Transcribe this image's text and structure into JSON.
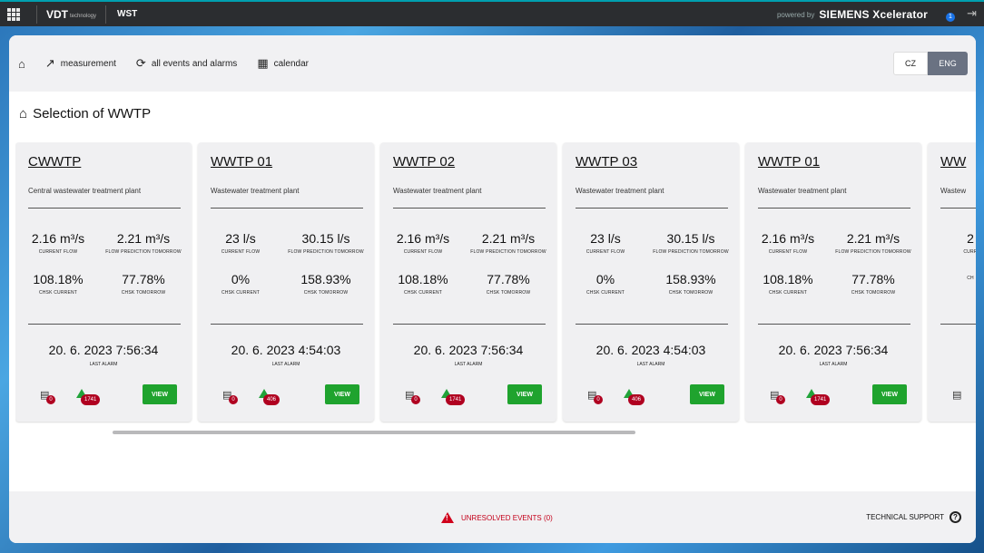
{
  "topbar": {
    "logo_main": "VDT",
    "logo_sub": "technology",
    "app": "WST",
    "powered_by": "powered by",
    "brand": "SIEMENS Xcelerator",
    "notification_count": "1"
  },
  "nav": {
    "items": [
      {
        "label": "measurement"
      },
      {
        "label": "all events and alarms"
      },
      {
        "label": "calendar"
      }
    ],
    "lang_cz": "CZ",
    "lang_eng": "ENG"
  },
  "page_title": "Selection of WWTP",
  "cards": [
    {
      "title": "CWWTP",
      "subtitle": "Central wastewater treatment plant",
      "flow": "2.16 m³/s",
      "flow_label": "CURRENT FLOW",
      "pred": "2.21 m³/s",
      "pred_label": "FLOW PREDICTION TOMORROW",
      "chsk": "108.18%",
      "chsk_label": "CHSK CURRENT",
      "chsk_tm": "77.78%",
      "chsk_tm_label": "CHSK TOMORROW",
      "date": "20. 6. 2023 7:56:34",
      "date_label": "LAST ALARM",
      "cal_count": "0",
      "alarm_count": "1741",
      "view": "VIEW"
    },
    {
      "title": "WWTP 01",
      "subtitle": "Wastewater treatment plant",
      "flow": "23 l/s",
      "flow_label": "CURRENT FLOW",
      "pred": "30.15 l/s",
      "pred_label": "FLOW PREDICTION TOMORROW",
      "chsk": "0%",
      "chsk_label": "CHSK CURRENT",
      "chsk_tm": "158.93%",
      "chsk_tm_label": "CHSK TOMORROW",
      "date": "20. 6. 2023 4:54:03",
      "date_label": "LAST ALARM",
      "cal_count": "0",
      "alarm_count": "406",
      "view": "VIEW"
    },
    {
      "title": "WWTP 02",
      "subtitle": "Wastewater treatment plant",
      "flow": "2.16 m³/s",
      "flow_label": "CURRENT FLOW",
      "pred": "2.21 m³/s",
      "pred_label": "FLOW PREDICTION TOMORROW",
      "chsk": "108.18%",
      "chsk_label": "CHSK CURRENT",
      "chsk_tm": "77.78%",
      "chsk_tm_label": "CHSK TOMORROW",
      "date": "20. 6. 2023 7:56:34",
      "date_label": "LAST ALARM",
      "cal_count": "0",
      "alarm_count": "1741",
      "view": "VIEW"
    },
    {
      "title": "WWTP 03",
      "subtitle": "Wastewater treatment plant",
      "flow": "23 l/s",
      "flow_label": "CURRENT FLOW",
      "pred": "30.15 l/s",
      "pred_label": "FLOW PREDICTION TOMORROW",
      "chsk": "0%",
      "chsk_label": "CHSK CURRENT",
      "chsk_tm": "158.93%",
      "chsk_tm_label": "CHSK TOMORROW",
      "date": "20. 6. 2023 4:54:03",
      "date_label": "LAST ALARM",
      "cal_count": "0",
      "alarm_count": "406",
      "view": "VIEW"
    },
    {
      "title": "WWTP 01",
      "subtitle": "Wastewater treatment plant",
      "flow": "2.16 m³/s",
      "flow_label": "CURRENT FLOW",
      "pred": "2.21 m³/s",
      "pred_label": "FLOW PREDICTION TOMORROW",
      "chsk": "108.18%",
      "chsk_label": "CHSK CURRENT",
      "chsk_tm": "77.78%",
      "chsk_tm_label": "CHSK TOMORROW",
      "date": "20. 6. 2023 7:56:34",
      "date_label": "LAST ALARM",
      "cal_count": "0",
      "alarm_count": "1741",
      "view": "VIEW"
    },
    {
      "title": "WW",
      "subtitle": "Wastew",
      "flow": "2",
      "flow_label": "CURR",
      "pred": "",
      "pred_label": "",
      "chsk": "",
      "chsk_label": "CH",
      "chsk_tm": "",
      "chsk_tm_label": "",
      "date": "2",
      "date_label": "",
      "cal_count": "",
      "alarm_count": "",
      "view": ""
    }
  ],
  "footer": {
    "unresolved": "UNRESOLVED EVENTS (0)",
    "support": "TECHNICAL SUPPORT"
  }
}
